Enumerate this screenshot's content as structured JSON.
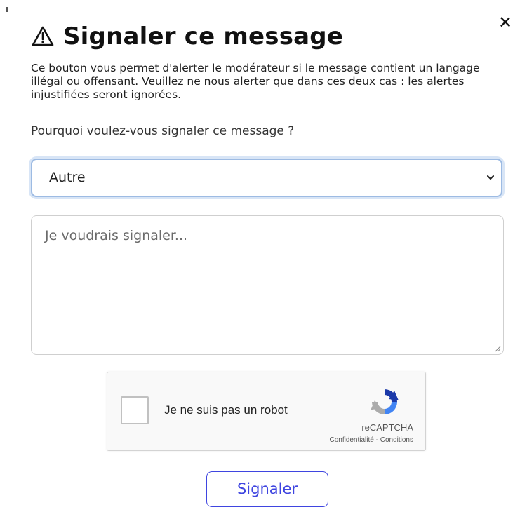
{
  "dialog": {
    "title": "Signaler ce message",
    "title_icon": "warning-triangle-icon",
    "close_icon": "close-icon",
    "close_label": "✕",
    "description": "Ce bouton vous permet d'alerter le modérateur si le message contient un langage illégal ou offensant. Veuillez ne nous alerter que dans ces deux cas : les alertes injustifiées seront ignorées.",
    "question": "Pourquoi voulez-vous signaler ce message ?"
  },
  "reason_select": {
    "selected": "Autre",
    "icon": "chevron-down-icon"
  },
  "message_field": {
    "value": "",
    "placeholder": "Je voudrais signaler..."
  },
  "captcha": {
    "checked": false,
    "label": "Je ne suis pas un robot",
    "brand": "reCAPTCHA",
    "privacy_link": "Confidentialité",
    "separator": " - ",
    "terms_link": "Conditions",
    "icon": "recaptcha-logo-icon"
  },
  "submit": {
    "label": "Signaler",
    "color": "#3f45e0"
  }
}
